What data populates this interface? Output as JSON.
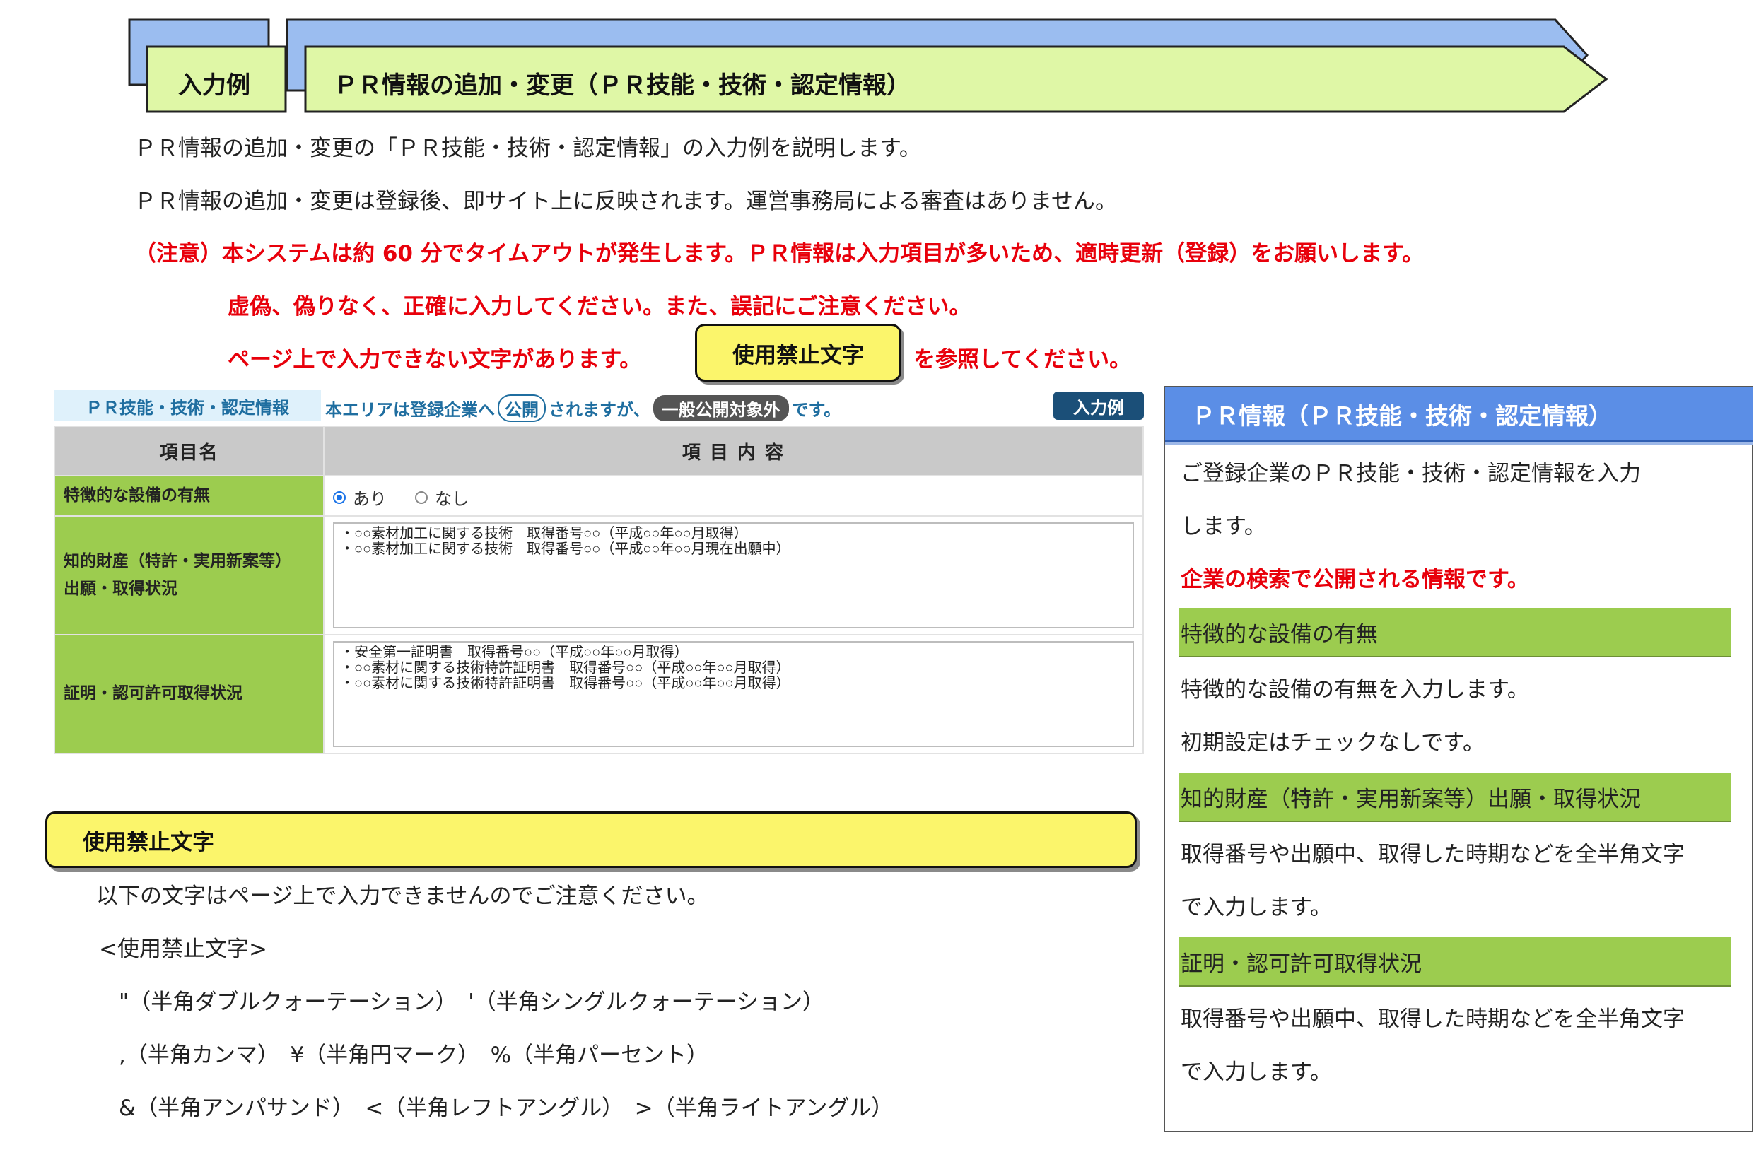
{
  "header": {
    "tag_label": "入力例",
    "title": "ＰＲ情報の追加・変更（ＰＲ技能・技術・認定情報）",
    "colors": {
      "tag_fill": "#dff7a6",
      "back_fill": "#9bbdf0",
      "outline": "#222222"
    }
  },
  "intro": {
    "line1": "ＰＲ情報の追加・変更の「ＰＲ技能・技術・認定情報」の入力例を説明します。",
    "line2": "ＰＲ情報の追加・変更は登録後、即サイト上に反映されます。運営事務局による審査はありません。"
  },
  "warning": {
    "line1": "（注意）本システムは約 60 分でタイムアウトが発生します。ＰＲ情報は入力項目が多いため、適時更新（登録）をお願いします。",
    "line2": "虚偽、偽りなく、正確に入力してください。また、誤記にご注意ください。",
    "line3_before": "ページ上で入力できない文字があります。",
    "ref_button": "使用禁止文字",
    "line3_after": "を参照してください。",
    "color": "#e8000b"
  },
  "form": {
    "section_tag": "ＰＲ技能・技術・認定情報",
    "note_prefix": "本エリアは登録企業へ",
    "note_public": "公開",
    "note_mid": "されますが、",
    "note_excluded": "一般公開対象外",
    "note_suffix": "です。",
    "example_button": "入力例",
    "col_item": "項目名",
    "col_content": "項 目 内 容",
    "rows": [
      {
        "label": "特徴的な設備の有無",
        "radio_yes": "あり",
        "radio_no": "なし",
        "selected": "あり"
      },
      {
        "label_line1": "知的財産（特許・実用新案等）",
        "label_line2": "出願・取得状況",
        "value": "・○○素材加工に関する技術　取得番号○○（平成○○年○○月取得）\n・○○素材加工に関する技術　取得番号○○（平成○○年○○月現在出願中）"
      },
      {
        "label": "証明・認可許可取得状況",
        "value": "・安全第一証明書　取得番号○○（平成○○年○○月取得）\n・○○素材に関する技術特許証明書　取得番号○○（平成○○年○○月取得）\n・○○素材に関する技術特許証明書　取得番号○○（平成○○年○○月取得）"
      }
    ]
  },
  "forbidden": {
    "title": "使用禁止文字",
    "intro": "以下の文字はページ上で入力できませんのでご注意ください。",
    "heading": "<使用禁止文字>",
    "line1": "\"（半角ダブルクォーテーション）　'（半角シングルクォーテーション）",
    "line2": ",（半角カンマ）　¥（半角円マーク）　%（半角パーセント）",
    "line3": "&（半角アンパサンド）　<（半角レフトアングル）　>（半角ライトアングル）"
  },
  "panel": {
    "title": "ＰＲ情報（ＰＲ技能・技術・認定情報）",
    "desc1": "ご登録企業のＰＲ技能・技術・認定情報を入力",
    "desc2": "します。",
    "public_note": "企業の検索で公開される情報です。",
    "items": [
      {
        "heading": "特徴的な設備の有無",
        "text1": "特徴的な設備の有無を入力します。",
        "text2": "初期設定はチェックなしです。"
      },
      {
        "heading": "知的財産（特許・実用新案等）出願・取得状況",
        "text1": "取得番号や出願中、取得した時期などを全半角文字",
        "text2": "で入力します。"
      },
      {
        "heading": "証明・認可許可取得状況",
        "text1": "取得番号や出願中、取得した時期などを全半角文字",
        "text2": "で入力します。"
      }
    ],
    "colors": {
      "title_bg": "#5b8ee6",
      "heading_bg": "#9ccc4f"
    }
  }
}
